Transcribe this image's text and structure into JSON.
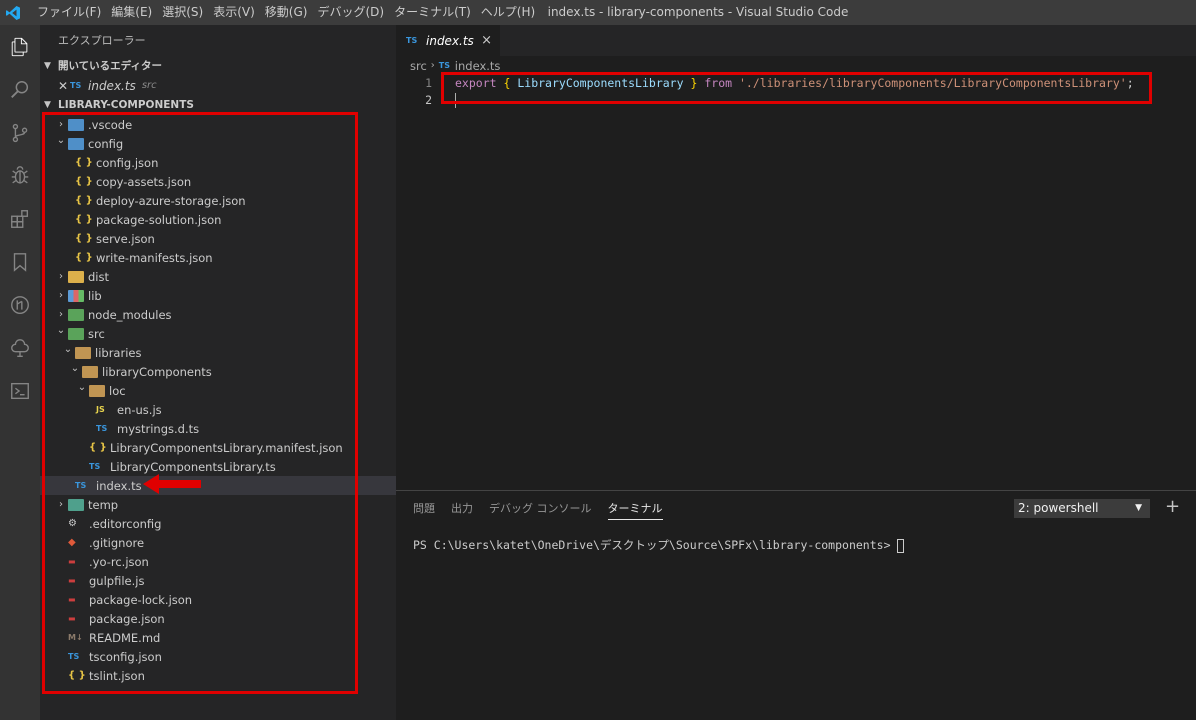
{
  "titlebar": {
    "menu": [
      "ファイル(F)",
      "編集(E)",
      "選択(S)",
      "表示(V)",
      "移動(G)",
      "デバッグ(D)",
      "ターミナル(T)",
      "ヘルプ(H)"
    ],
    "window_title": "index.ts - library-components - Visual Studio Code"
  },
  "activity_icons": [
    "files-icon",
    "search-icon",
    "source-control-icon",
    "debug-icon",
    "extensions-icon",
    "bookmark-icon",
    "git-history-icon",
    "azure-icon",
    "powershell-icon"
  ],
  "sidebar": {
    "title": "エクスプローラー",
    "open_editors": {
      "header": "開いているエディター",
      "items": [
        {
          "badge": "TS",
          "name": "index.ts",
          "desc": "src"
        }
      ]
    },
    "project": {
      "header": "LIBRARY-COMPONENTS",
      "tree": [
        {
          "name": ".vscode",
          "type": "folder",
          "color": "blue",
          "depth": 0,
          "expanded": false
        },
        {
          "name": "config",
          "type": "folder",
          "color": "blue",
          "depth": 0,
          "expanded": true
        },
        {
          "name": "config.json",
          "type": "json",
          "depth": 1
        },
        {
          "name": "copy-assets.json",
          "type": "json",
          "depth": 1
        },
        {
          "name": "deploy-azure-storage.json",
          "type": "json",
          "depth": 1
        },
        {
          "name": "package-solution.json",
          "type": "json",
          "depth": 1
        },
        {
          "name": "serve.json",
          "type": "json",
          "depth": 1
        },
        {
          "name": "write-manifests.json",
          "type": "json",
          "depth": 1
        },
        {
          "name": "dist",
          "type": "folder",
          "color": "yellow",
          "depth": 0,
          "expanded": false
        },
        {
          "name": "lib",
          "type": "folder",
          "color": "multi",
          "depth": 0,
          "expanded": false
        },
        {
          "name": "node_modules",
          "type": "folder",
          "color": "green",
          "depth": 0,
          "expanded": false
        },
        {
          "name": "src",
          "type": "folder",
          "color": "green",
          "depth": 0,
          "expanded": true
        },
        {
          "name": "libraries",
          "type": "folder",
          "color": "open",
          "depth": 1,
          "expanded": true
        },
        {
          "name": "libraryComponents",
          "type": "folder",
          "color": "open",
          "depth": 2,
          "expanded": true
        },
        {
          "name": "loc",
          "type": "folder",
          "color": "open",
          "depth": 3,
          "expanded": true
        },
        {
          "name": "en-us.js",
          "type": "js",
          "depth": 4
        },
        {
          "name": "mystrings.d.ts",
          "type": "ts",
          "depth": 4
        },
        {
          "name": "LibraryComponentsLibrary.manifest.json",
          "type": "json",
          "depth": 3
        },
        {
          "name": "LibraryComponentsLibrary.ts",
          "type": "ts",
          "depth": 3
        },
        {
          "name": "index.ts",
          "type": "ts",
          "depth": 1,
          "selected": true
        },
        {
          "name": "temp",
          "type": "folder",
          "color": "teal",
          "depth": 0,
          "expanded": false
        },
        {
          "name": ".editorconfig",
          "type": "gear",
          "depth": 0
        },
        {
          "name": ".gitignore",
          "type": "git",
          "depth": 0
        },
        {
          "name": ".yo-rc.json",
          "type": "red",
          "depth": 0
        },
        {
          "name": "gulpfile.js",
          "type": "red",
          "depth": 0
        },
        {
          "name": "package-lock.json",
          "type": "red",
          "depth": 0
        },
        {
          "name": "package.json",
          "type": "red",
          "depth": 0
        },
        {
          "name": "README.md",
          "type": "md",
          "depth": 0
        },
        {
          "name": "tsconfig.json",
          "type": "ts",
          "depth": 0
        },
        {
          "name": "tslint.json",
          "type": "json",
          "depth": 0
        }
      ]
    }
  },
  "editor": {
    "tab": {
      "badge": "TS",
      "title": "index.ts",
      "close": "×"
    },
    "breadcrumbs": {
      "folder": "src",
      "badge": "TS",
      "file": "index.ts"
    },
    "lines": [
      {
        "num": "1",
        "kw1": "export",
        "ob": "{",
        "ident": "LibraryComponentsLibrary",
        "cb": "}",
        "kw2": "from",
        "str": "'./libraries/libraryComponents/LibraryComponentsLibrary'",
        "semi": ";"
      },
      {
        "num": "2"
      }
    ]
  },
  "panel": {
    "tabs": [
      "問題",
      "出力",
      "デバッグ コンソール",
      "ターミナル"
    ],
    "active_tab": "ターミナル",
    "terminal_select": "2: powershell",
    "add_label": "+",
    "prompt": "PS C:\\Users\\katet\\OneDrive\\デスクトップ\\Source\\SPFx\\library-components> "
  }
}
